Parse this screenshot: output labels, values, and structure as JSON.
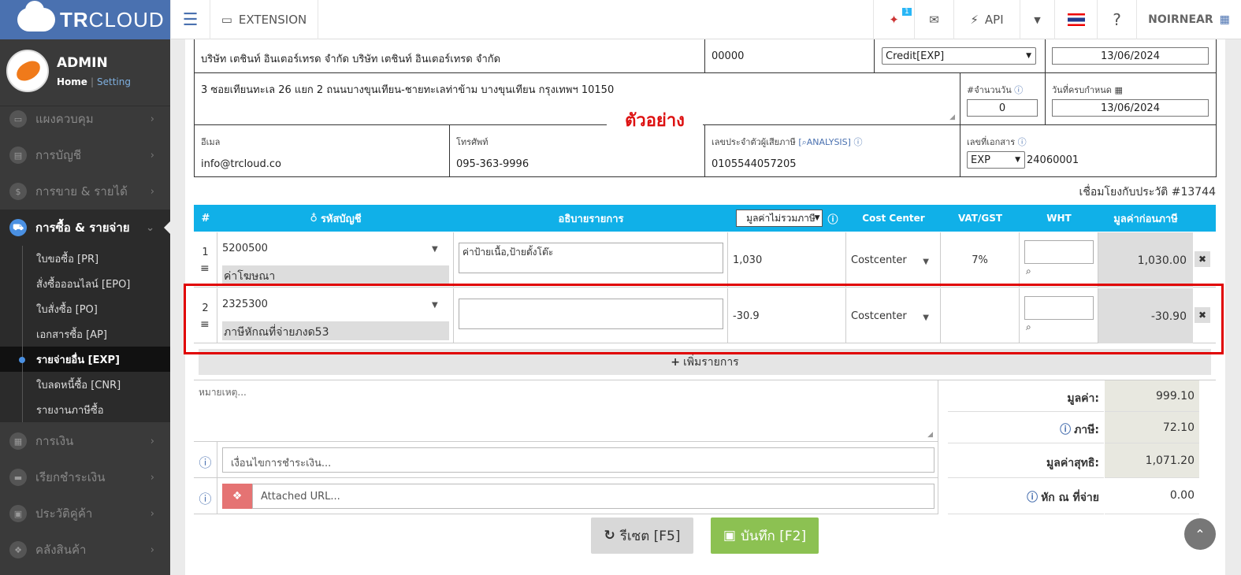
{
  "topbar": {
    "logo": {
      "bold": "TR",
      "light": "CLOUD"
    },
    "menu_icon": "hamburger-icon",
    "extension_label": "EXTENSION",
    "notif_badge": "1",
    "api_label": "API",
    "user_label": "NOIRNEAR"
  },
  "sidebar": {
    "admin_name": "ADMIN",
    "home": "Home",
    "sep": "|",
    "setting": "Setting",
    "menus": [
      {
        "label": "แผงควบคุม",
        "icon": "monitor-icon"
      },
      {
        "label": "การบัญชี",
        "icon": "book-icon"
      },
      {
        "label": "การขาย & รายได้",
        "icon": "dollar-icon"
      },
      {
        "label": "การซื้อ & รายจ่าย",
        "icon": "cart-icon"
      },
      {
        "label": "การเงิน",
        "icon": "calendar-icon"
      },
      {
        "label": "เรียกชำระเงิน",
        "icon": "card-icon"
      },
      {
        "label": "ประวัติคู่ค้า",
        "icon": "contact-icon"
      },
      {
        "label": "คลังสินค้า",
        "icon": "cubes-icon"
      }
    ],
    "submenus": [
      "ใบขอซื้อ [PR]",
      "สั่งซื้อออนไลน์ [EPO]",
      "ใบสั่งซื้อ [PO]",
      "เอกสารซื้อ [AP]",
      "รายจ่ายอื่น [EXP]",
      "ใบลดหนี้ซื้อ [CNR]",
      "รายงานภาษีซื้อ"
    ]
  },
  "form": {
    "company": "บริษัท เตชินท์ อินเตอร์เทรด จำกัด บริษัท เตชินท์ อินเตอร์เทรด จำกัด",
    "branch": "00000",
    "payment_select": "Credit[EXP]",
    "doc_date": "13/06/2024",
    "address": "3 ซอยเทียนทะเล 26 แยก 2 ถนนบางขุนเทียน-ชายทะเลท่าข้าม บางขุนเทียน กรุงเทพฯ 10150",
    "days_label": "#จำนวนวัน",
    "days_value": "0",
    "due_label": "วันที่ครบกำหนด",
    "due_date": "13/06/2024",
    "email_label": "อีเมล",
    "email": "info@trcloud.co",
    "phone_label": "โทรศัพท์",
    "phone": "095-363-9996",
    "taxid_label": "เลขประจำตัวผู้เสียภาษี",
    "analysis_label": "ANALYSIS",
    "taxid": "0105544057205",
    "docno_label": "เลขที่เอกสาร",
    "doc_prefix": "EXP",
    "doc_no": "24060001",
    "stamp": "ตัวอย่าง",
    "history_link": "เชื่อมโยงกับประวัติ #13744"
  },
  "table": {
    "headers": {
      "num": "#",
      "account": "รหัสบัญชี",
      "desc": "อธิบายรายการ",
      "value_select": "มูลค่าไม่รวมภาษี",
      "cost_center": "Cost Center",
      "vat": "VAT/GST",
      "wht": "WHT",
      "pretax": "มูลค่าก่อนภาษี"
    },
    "rows": [
      {
        "num": "1",
        "code": "5200500",
        "name": "ค่าโฆษณา",
        "desc": "ค่าป้ายเนื้อ,ป้ายตั้งโต๊ะ",
        "value": "1,030",
        "cost_center": "Costcenter",
        "vat": "7%",
        "pretax": "1,030.00"
      },
      {
        "num": "2",
        "code": "2325300",
        "name": "ภาษีหักณที่จ่ายภงด53",
        "desc": "",
        "value": "-30.9",
        "cost_center": "Costcenter",
        "vat": "",
        "pretax": "-30.90"
      }
    ],
    "add_row": "เพิ่มรายการ"
  },
  "footer": {
    "note_placeholder": "หมายเหตุ...",
    "condition_placeholder": "เงื่อนไขการชำระเงิน...",
    "url_placeholder": "Attached URL...",
    "value_label": "มูลค่า:",
    "value": "999.10",
    "tax_label": "ภาษี:",
    "tax": "72.10",
    "net_label": "มูลค่าสุทธิ:",
    "net": "1,071.20",
    "wht_label": "หัก ณ ที่จ่าย",
    "wht": "0.00",
    "reset_button": "รีเซต [F5]",
    "save_button": "บันทึก [F2]"
  },
  "colors": {
    "logo_bg": "#4a71b0",
    "table_header": "#10b0e8",
    "save_green": "#8cc152",
    "highlight_red": "#e00000"
  }
}
